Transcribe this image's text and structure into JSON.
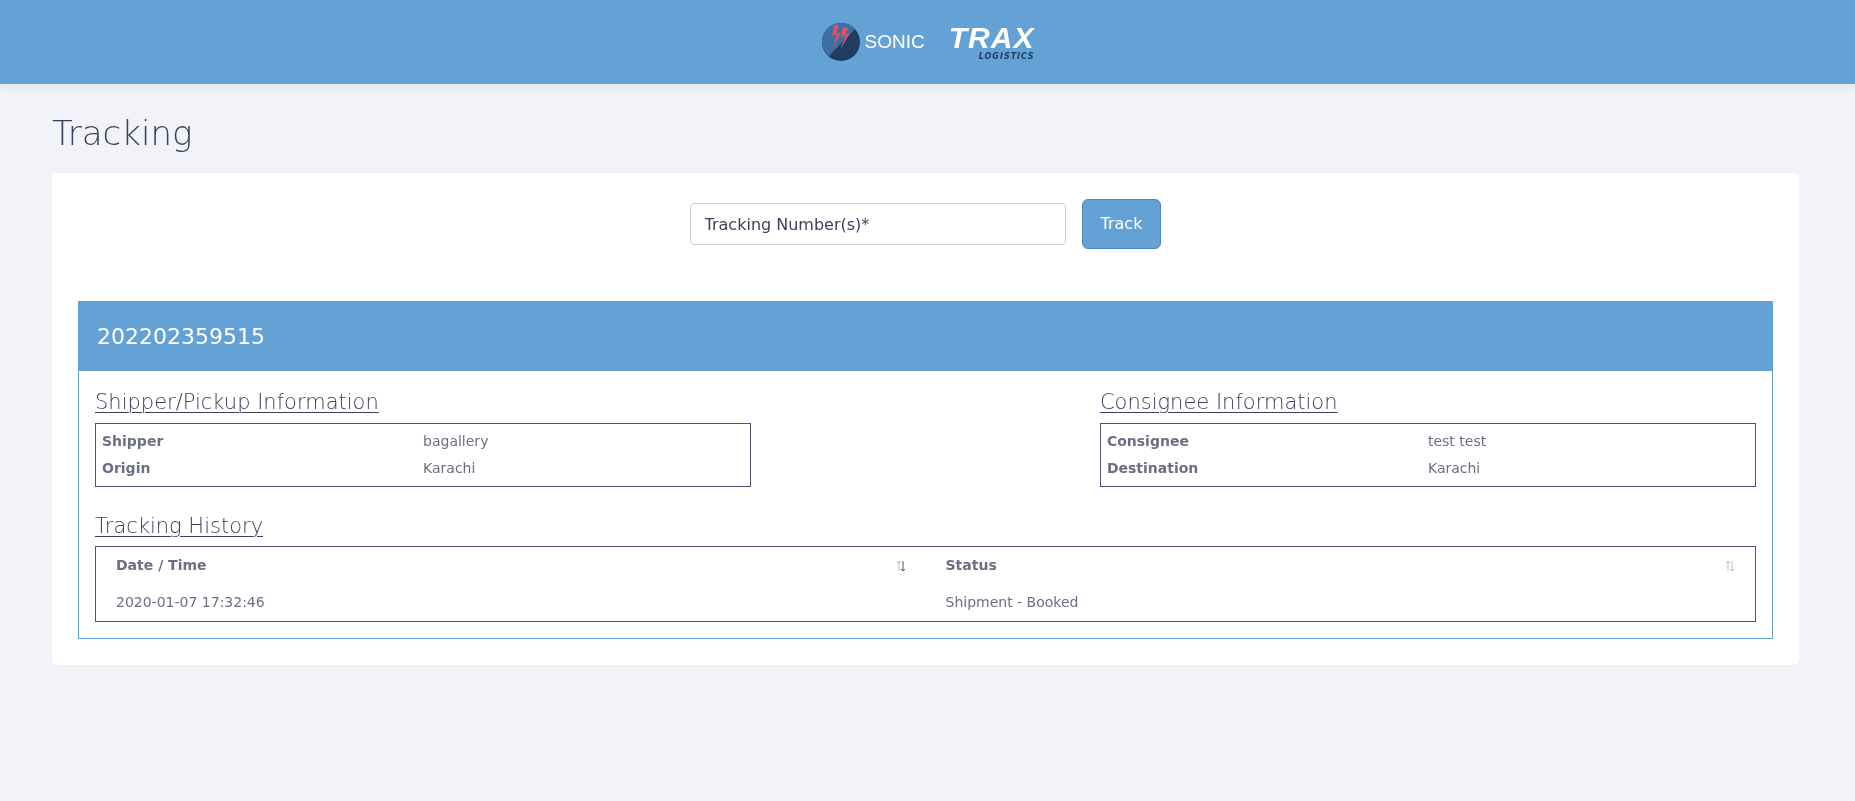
{
  "header": {
    "logos": [
      {
        "kind": "sonic",
        "text": "SONIC"
      },
      {
        "kind": "trax",
        "text": "TRAX",
        "subtext": "LOGISTICS"
      }
    ]
  },
  "page_title": "Tracking",
  "search": {
    "placeholder": "Tracking Number(s)*",
    "button": "Track"
  },
  "result": {
    "tracking_number": "202202359515",
    "sections": [
      {
        "title": "Shipper/Pickup Information",
        "rows": [
          {
            "label": "Shipper",
            "value": "bagallery"
          },
          {
            "label": "Origin",
            "value": "Karachi"
          }
        ]
      },
      {
        "title": "Consignee Information",
        "rows": [
          {
            "label": "Consignee",
            "value": "test test"
          },
          {
            "label": "Destination",
            "value": "Karachi"
          }
        ]
      }
    ],
    "history": {
      "title": "Tracking History",
      "columns": [
        {
          "label": "Date / Time",
          "sorted": true
        },
        {
          "label": "Status",
          "sorted": false
        }
      ],
      "rows": [
        [
          "2020-01-07 17:32:46",
          "Shipment - Booked"
        ]
      ]
    }
  }
}
